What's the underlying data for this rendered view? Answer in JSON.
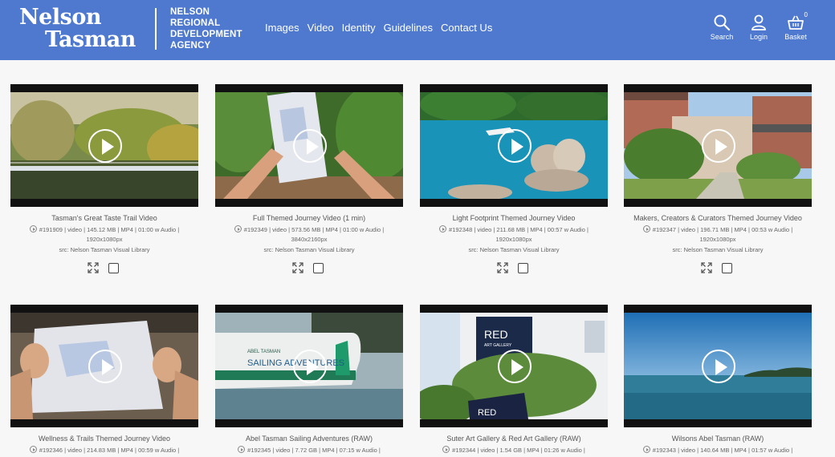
{
  "brand": {
    "logo_line1": "Nelson",
    "logo_line2": "Tasman",
    "agency_lines": [
      "NELSON",
      "REGIONAL",
      "DEVELOPMENT",
      "AGENCY"
    ]
  },
  "nav": [
    "Images",
    "Video",
    "Identity",
    "Guidelines",
    "Contact Us"
  ],
  "header_actions": {
    "search": "Search",
    "login": "Login",
    "basket": "Basket",
    "basket_count": "0"
  },
  "colors": {
    "header": "#4f79cf",
    "background": "#f7f7f7"
  },
  "videos": [
    {
      "title": "Tasman's Great Taste Trail Video",
      "meta1": "#191909 | video | 145.12 MB | MP4 | 01:00 w Audio |",
      "meta2": "1920x1080px",
      "src": "src: Nelson Tasman Visual Library"
    },
    {
      "title": "Full Themed Journey Video (1 min)",
      "meta1": "#192349 | video | 573.56 MB | MP4 | 01:00 w Audio |",
      "meta2": "3840x2160px",
      "src": "src: Nelson Tasman Visual Library"
    },
    {
      "title": "Light Footprint Themed Journey Video",
      "meta1": "#192348 | video | 211.68 MB | MP4 | 00:57 w Audio |",
      "meta2": "1920x1080px",
      "src": "src: Nelson Tasman Visual Library"
    },
    {
      "title": "Makers, Creators & Curators Themed Journey Video",
      "meta1": "#192347 | video | 196.71 MB | MP4 | 00:53 w Audio |",
      "meta2": "1920x1080px",
      "src": "src: Nelson Tasman Visual Library"
    },
    {
      "title": "Wellness & Trails Themed Journey Video",
      "meta1": "#192346 | video | 214.83 MB | MP4 | 00:59 w Audio |",
      "meta2": "",
      "src": ""
    },
    {
      "title": "Abel Tasman Sailing Adventures (RAW)",
      "meta1": "#192345 | video | 7.72 GB | MP4 | 07:15 w Audio |",
      "meta2": "",
      "src": ""
    },
    {
      "title": "Suter Art Gallery & Red Art Gallery (RAW)",
      "meta1": "#192344 | video | 1.54 GB | MP4 | 01:26 w Audio |",
      "meta2": "",
      "src": ""
    },
    {
      "title": "Wilsons Abel Tasman (RAW)",
      "meta1": "#192343 | video | 140.64 MB | MP4 | 01:57 w Audio |",
      "meta2": "",
      "src": ""
    }
  ],
  "thumb_text": {
    "sailing_boat": "SAILING ADVENTURES",
    "boat_small": "ABEL TASMAN",
    "gallery_red": "RED",
    "gallery_sub": "ART GALLERY",
    "gallery_red2": "RED"
  }
}
